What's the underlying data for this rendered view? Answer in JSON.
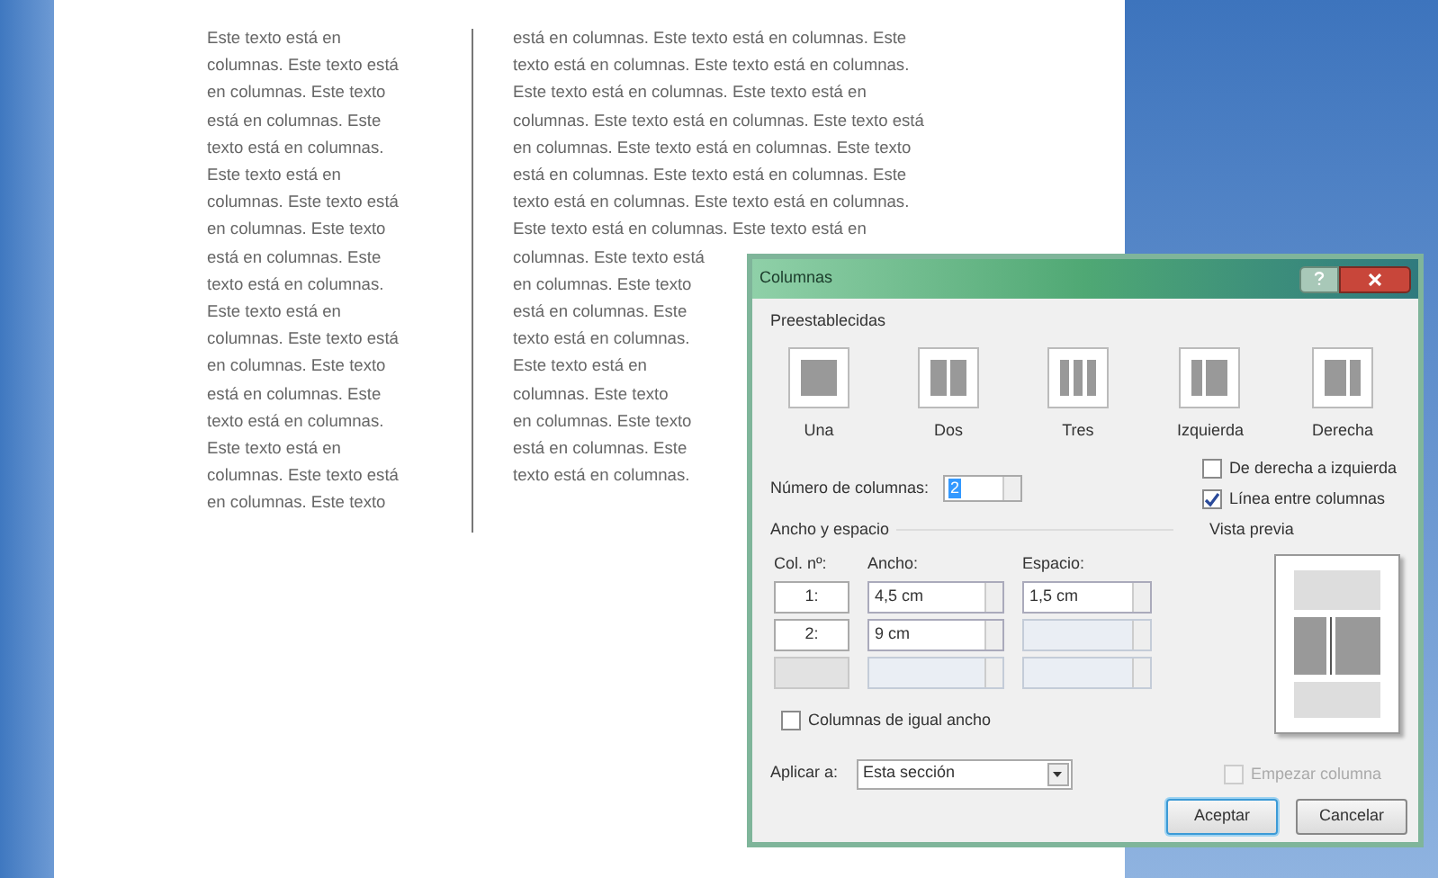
{
  "document": {
    "column_1_lines": [
      "Este texto está en",
      "columnas. Este texto está",
      "en columnas. Este texto",
      "está en columnas. Este",
      "texto está en columnas.",
      "Este texto está en",
      "columnas. Este texto está",
      "en columnas. Este texto",
      "está en columnas. Este",
      "texto está en columnas.",
      "Este texto está en",
      "columnas. Este texto está",
      "en columnas. Este texto",
      "está en columnas. Este",
      "texto está en columnas.",
      "Este texto está en",
      "columnas. Este texto está",
      "en columnas. Este texto"
    ],
    "column_2_lines": [
      "está en columnas. Este texto está en columnas. Este",
      "texto está en columnas. Este texto está en columnas.",
      "Este texto está en columnas. Este texto está en",
      "columnas. Este texto está en columnas. Este texto está",
      "en columnas. Este texto está en columnas. Este texto",
      "está en columnas. Este texto está en columnas. Este",
      "texto está en columnas. Este texto está en columnas.",
      "Este texto está en columnas. Este texto está en",
      "columnas. Este texto está",
      "en columnas. Este texto",
      "está en columnas. Este",
      "texto está en columnas.",
      "Este texto está en",
      "columnas. Este texto",
      "en columnas. Este texto",
      "está en columnas. Este",
      "texto está en columnas."
    ]
  },
  "dialog": {
    "title": "Columnas",
    "presets_label": "Preestablecidas",
    "presets": [
      {
        "kind": "one",
        "label": "Una",
        "selected": false
      },
      {
        "kind": "two",
        "label": "Dos",
        "selected": false
      },
      {
        "kind": "three",
        "label": "Tres",
        "selected": false
      },
      {
        "kind": "left",
        "label": "Izquierda",
        "selected": false
      },
      {
        "kind": "right",
        "label": "Derecha",
        "selected": false
      }
    ],
    "number_label": "Número de columnas:",
    "number_value": "2",
    "right_to_left": {
      "label": "De derecha a izquierda",
      "checked": false
    },
    "line_between": {
      "label": "Línea entre columnas",
      "checked": true
    },
    "group_label": "Ancho y espacio",
    "headers": [
      "Col. nº:",
      "Ancho:",
      "Espacio:"
    ],
    "rows": [
      {
        "number": "1:",
        "width": "4,5 cm",
        "spacing": "1,5 cm",
        "disabled": false
      },
      {
        "number": "2:",
        "width": "9 cm",
        "disabled": false
      },
      {
        "disabled": true
      }
    ],
    "equal_width": {
      "label": "Columnas de igual ancho",
      "checked": false
    },
    "apply_label": "Aplicar a:",
    "apply_value": "Esta sección",
    "preview_label": "Vista previa",
    "start_column": {
      "label": "Empezar columna",
      "checked": false,
      "disabled": true
    },
    "buttons": [
      {
        "label": "Aceptar",
        "default": true
      },
      {
        "label": "Cancelar",
        "default": false
      }
    ]
  }
}
